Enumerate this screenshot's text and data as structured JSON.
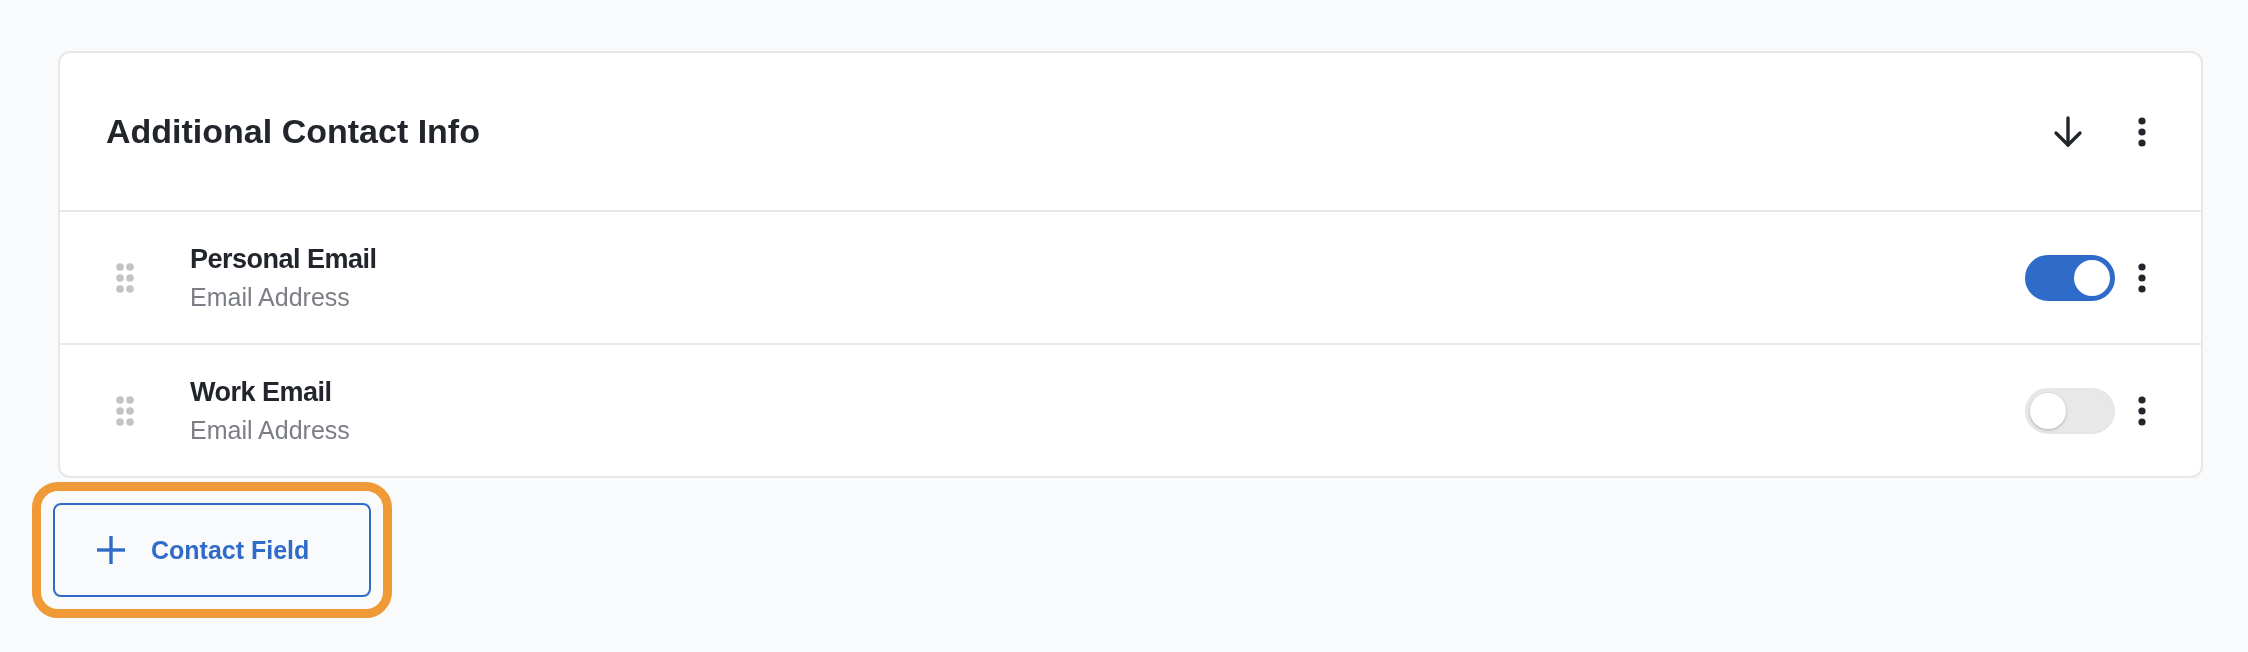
{
  "card": {
    "title": "Additional Contact Info"
  },
  "fields": [
    {
      "name": "Personal Email",
      "type_label": "Email Address",
      "on": true
    },
    {
      "name": "Work Email",
      "type_label": "Email Address",
      "on": false
    }
  ],
  "add_button": {
    "label": "Contact Field",
    "focused": true
  }
}
